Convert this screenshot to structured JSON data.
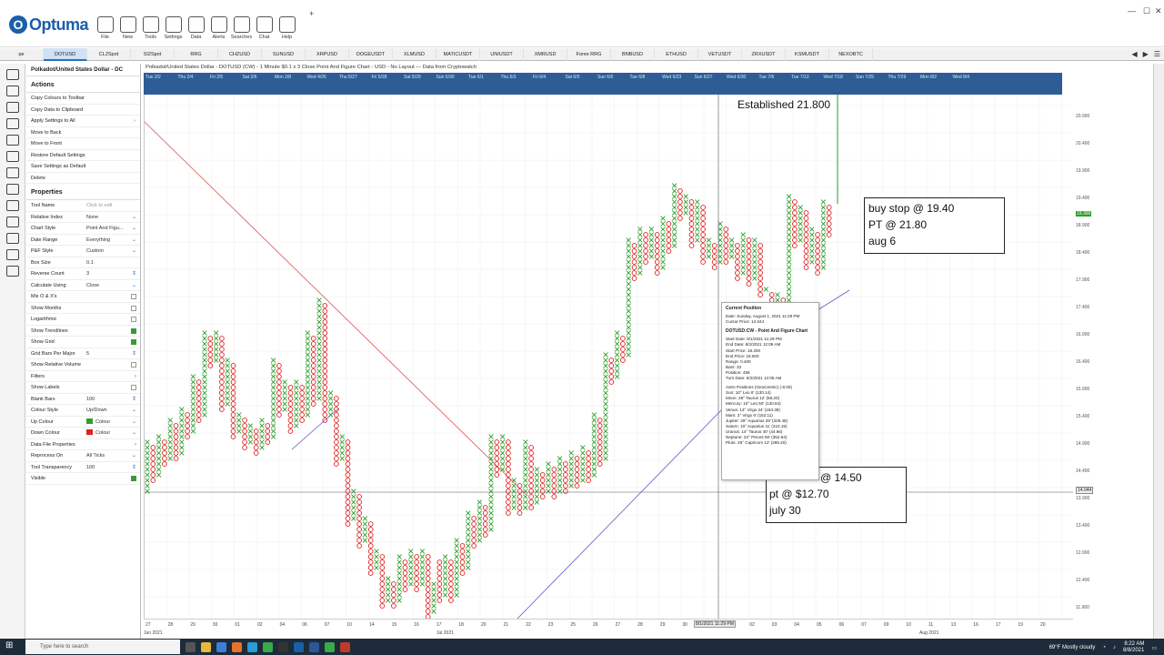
{
  "app": {
    "name": "Optuma"
  },
  "toolbar": {
    "items": [
      {
        "label": "File",
        "icon": "folder-icon"
      },
      {
        "label": "New",
        "icon": "new-document-icon"
      },
      {
        "label": "Tools",
        "icon": "tools-icon"
      },
      {
        "label": "Settings",
        "icon": "gear-icon"
      },
      {
        "label": "Data",
        "icon": "binary-data-icon"
      },
      {
        "label": "Alerts",
        "icon": "alarm-clock-icon"
      },
      {
        "label": "Searches",
        "icon": "magnifier-icon"
      },
      {
        "label": "Chat",
        "icon": "chat-bubble-icon"
      },
      {
        "label": "Help",
        "icon": "question-icon"
      }
    ]
  },
  "tabs": [
    "pe",
    "DOTUSD",
    "CL2Spot",
    "SI2Spot",
    "RRG",
    "CHZUSD",
    "SUNUSD",
    "XRPUSD",
    "DOGEUSDT",
    "XLMUSD",
    "MATICUSDT",
    "UNIUSDT",
    "XMRUSD",
    "Forex RRG",
    "BNBUSD",
    "ETHUSD",
    "VETUSDT",
    "ZRXUSDT",
    "KSMUSDT",
    "NEXOBTC"
  ],
  "active_tab": "DOTUSD",
  "panel": {
    "title": "Polkadot/United States Dollar - DC",
    "actions_heading": "Actions",
    "actions": [
      "Copy Colours to Toolbar",
      "Copy Data to Clipboard",
      "Apply Settings to All",
      "Move to Back",
      "Move to Front",
      "Restore Default Settings",
      "Save Settings as Default",
      "Delete"
    ],
    "properties_heading": "Properties",
    "properties": [
      {
        "k": "Tool Name",
        "v": "Click to edit"
      },
      {
        "k": "Relative Index",
        "v": "None"
      },
      {
        "k": "Chart Style",
        "v": "Point And Figu..."
      },
      {
        "k": "Date Range",
        "v": "Everything"
      },
      {
        "k": "P&F Style",
        "v": "Custom"
      },
      {
        "k": "Box Size",
        "v": "0.1"
      },
      {
        "k": "Reverse Count",
        "v": "3"
      },
      {
        "k": "Calculate Using",
        "v": "Close"
      },
      {
        "k": "Mix O & X's",
        "v": ""
      },
      {
        "k": "Show Months",
        "v": ""
      },
      {
        "k": "Logarithmic",
        "v": ""
      },
      {
        "k": "Show Trendlines",
        "v": ""
      },
      {
        "k": "Show Grid",
        "v": ""
      },
      {
        "k": "Grid Bars Per Major",
        "v": "5"
      },
      {
        "k": "Show Relative Volume",
        "v": ""
      },
      {
        "k": "Filters",
        "v": ""
      },
      {
        "k": "Show Labels",
        "v": ""
      },
      {
        "k": "Blank Bars",
        "v": "100"
      },
      {
        "k": "Colour Style",
        "v": "Up/Down"
      },
      {
        "k": "Up Colour",
        "v": "Colour"
      },
      {
        "k": "Down Colour",
        "v": "Colour"
      },
      {
        "k": "Data File Properties",
        "v": ""
      },
      {
        "k": "Reprocess On",
        "v": "All Ticks"
      },
      {
        "k": "Tool Transparency",
        "v": "100"
      },
      {
        "k": "Visible",
        "v": ""
      }
    ]
  },
  "chart": {
    "title": "Polkadot/United States Dollar - DOTUSD (CW) - 1 Minute $0.1 x 3 Close Point And Figure Chart - USD - No Layout --- Data from Cryptowatch",
    "date_labels": [
      "Tue 2/2",
      "Thu 2/4",
      "Fri 2/5",
      "Sat 2/6",
      "Mon 2/8",
      "Wed 4/26",
      "Thu 5/27",
      "Fri 5/28",
      "Sat 5/29",
      "Sun 5/30",
      "Tue 6/1",
      "Thu 6/3",
      "Fri 6/4",
      "Sat 6/5",
      "Sun 6/6",
      "Tue 6/8",
      "Wed 6/23",
      "Sun 6/27",
      "Wed 6/30",
      "Tue 7/6",
      "Tue 7/13",
      "Wed 7/18",
      "Sun 7/25",
      "Thu 7/29",
      "Mon 8/2",
      "Wed 8/4"
    ],
    "y_ticks": [
      "20.900",
      "20.400",
      "19.900",
      "19.400",
      "18.900",
      "18.400",
      "17.900",
      "17.400",
      "16.900",
      "16.400",
      "15.900",
      "15.400",
      "14.900",
      "14.400",
      "13.900",
      "13.400",
      "12.900",
      "12.400",
      "11.900"
    ],
    "price_badge": "19.300",
    "cursor_badge": "14.044",
    "x_ticks": [
      "27",
      "28",
      "29",
      "30",
      "01",
      "02",
      "04",
      "06",
      "07",
      "10",
      "14",
      "15",
      "16",
      "17",
      "18",
      "20",
      "21",
      "22",
      "23",
      "25",
      "26",
      "27",
      "28",
      "29",
      "30",
      "31",
      "01",
      "02",
      "03",
      "04",
      "05",
      "06",
      "07",
      "09",
      "10",
      "11",
      "13",
      "16",
      "17",
      "19",
      "20"
    ],
    "x_months": [
      "Jun 2021",
      "Jul 2021",
      "Aug 2021"
    ],
    "x_cursor_badge": "8/1/2021 11:29 PM",
    "up_color": "#2aa12a",
    "down_color": "#e02020"
  },
  "annotations": {
    "established": "Established 21.800",
    "box1": [
      "buy stop @ 19.40",
      "PT @ 21.80",
      "aug 6"
    ],
    "box2": [
      "@ 14.50",
      "pt @ $12.70",
      "july 30"
    ]
  },
  "popup": {
    "heading": "Current Position",
    "lines1": [
      "Date: Sunday, August 1, 2021 11:29 PM",
      "Cursor Price: 14.044"
    ],
    "heading2": "DOTUSD:CW - Point And Figure Chart",
    "lines2": [
      "Start Date: 8/1/2021 11:29 PM",
      "End Date: 8/2/2021 12:06 AM",
      "Start Price: 18.200",
      "End Price: 18.600",
      "Range: 0.400",
      "Bars: 33",
      "Position: 456",
      "Turn Date: 8/2/2021 12:05 AM"
    ],
    "lines3": [
      "Astro Positions (GeoCentric) (-5:00)",
      "Sun: 10° Leo 8' (130.14)",
      "Moon: 28° Taurus 12' (58.20)",
      "Mercury: 10° Leo 50' (130.84)",
      "Venus: 13° Virgo 24' (163.39)",
      "Mars: 2° Virgo 6' (152.11)",
      "Jupiter: 29° Aquarius 29' (329.48)",
      "Saturn: 10° Aquarius 11' (310.19)",
      "Uranus: 14° Taurus 40' (44.66)",
      "Neptune: 22° Pisces 50' (352.84)",
      "Pluto: 25° Capricorn 12' (295.20)"
    ]
  },
  "taskbar": {
    "search": "Type here to search",
    "weather": "69°F  Mostly cloudy",
    "time": "8:22 AM",
    "date": "8/8/2021"
  }
}
